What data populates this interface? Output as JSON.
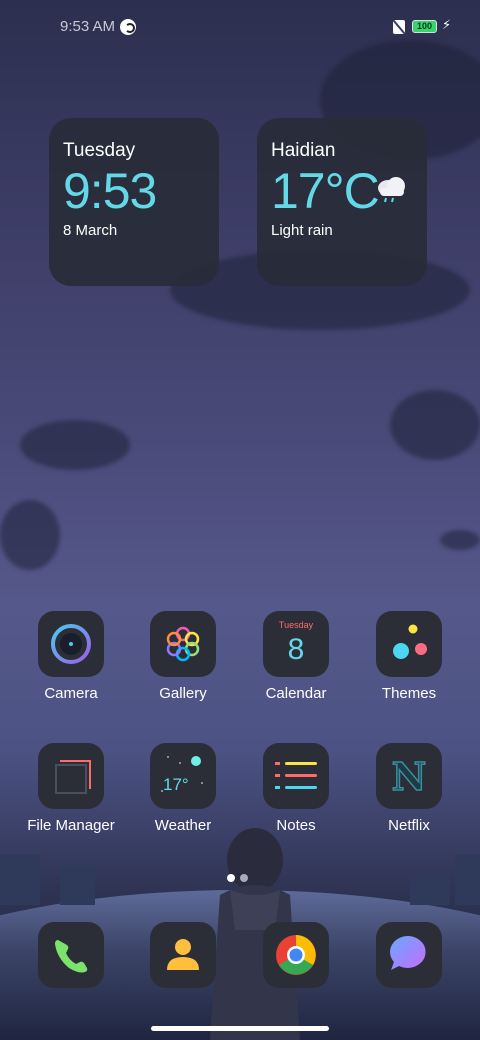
{
  "status_bar": {
    "time": "9:53 AM",
    "battery": "100"
  },
  "widgets": {
    "clock": {
      "day": "Tuesday",
      "time": "9:53",
      "date": "8 March"
    },
    "weather": {
      "location": "Haidian",
      "temperature": "17°C",
      "condition": "Light rain"
    }
  },
  "apps": {
    "row1": [
      {
        "label": "Camera",
        "icon": "camera-icon"
      },
      {
        "label": "Gallery",
        "icon": "gallery-icon"
      },
      {
        "label": "Calendar",
        "icon": "calendar-icon",
        "icon_text_top": "Tuesday",
        "icon_text_num": "8"
      },
      {
        "label": "Themes",
        "icon": "themes-icon"
      }
    ],
    "row2": [
      {
        "label": "File Manager",
        "icon": "folder-icon"
      },
      {
        "label": "Weather",
        "icon": "weather-icon",
        "icon_text": "17°"
      },
      {
        "label": "Notes",
        "icon": "notes-icon"
      },
      {
        "label": "Netflix",
        "icon": "netflix-icon",
        "icon_text": "N"
      }
    ]
  },
  "dock": [
    {
      "icon": "phone-icon"
    },
    {
      "icon": "contacts-icon"
    },
    {
      "icon": "chrome-icon"
    },
    {
      "icon": "messages-icon"
    }
  ],
  "colors": {
    "accent_cyan": "#64d8e6",
    "widget_bg": "#2b2e36",
    "battery_green": "#37d36d"
  }
}
